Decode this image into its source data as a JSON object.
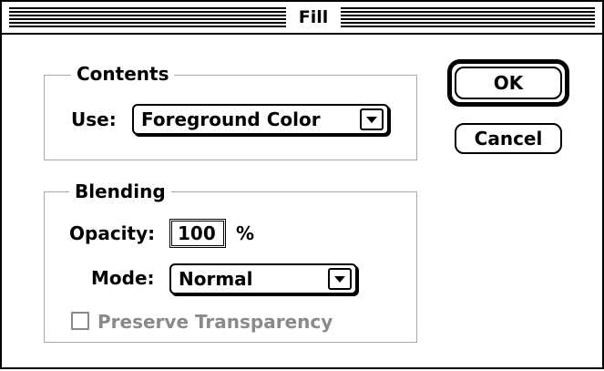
{
  "dialog": {
    "title": "Fill"
  },
  "contents": {
    "group_label": "Contents",
    "use_label": "Use:",
    "use_value": "Foreground Color"
  },
  "blending": {
    "group_label": "Blending",
    "opacity_label": "Opacity:",
    "opacity_value": "100",
    "opacity_unit": "%",
    "mode_label": "Mode:",
    "mode_value": "Normal",
    "preserve_transparency_label": "Preserve Transparency",
    "preserve_transparency_checked": false
  },
  "buttons": {
    "ok_label": "OK",
    "cancel_label": "Cancel"
  },
  "icons": {
    "popup_arrow": "chevron-down-icon",
    "checkbox": "checkbox-icon"
  },
  "colors": {
    "foreground": "#000000",
    "background": "#ffffff",
    "group_border": "#a8a8a8",
    "disabled_text": "#8a8a8a"
  }
}
